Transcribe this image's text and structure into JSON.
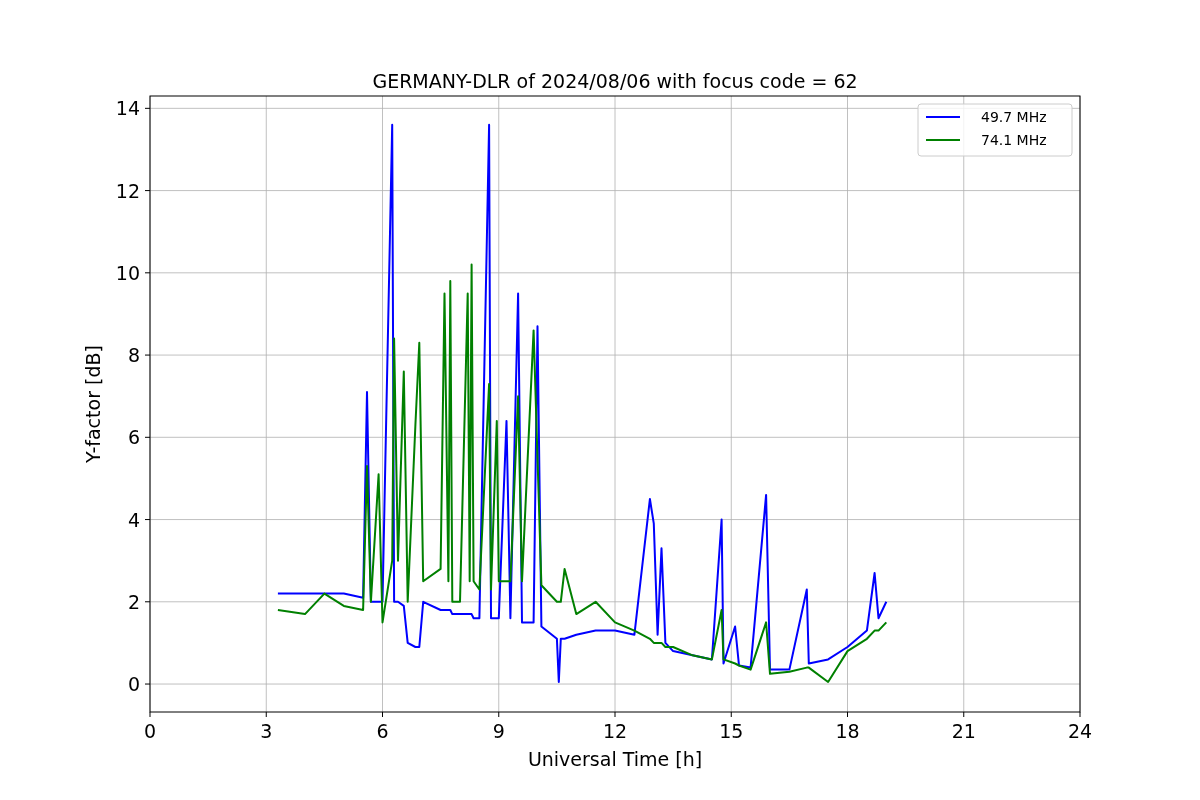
{
  "figure": {
    "chart_data": {
      "type": "line",
      "title": "GERMANY-DLR of 2024/08/06 with focus code = 62",
      "xlabel": "Universal Time [h]",
      "ylabel": "Y-factor [dB]",
      "x": [
        3.3,
        4.0,
        4.5,
        5.0,
        5.5,
        5.6,
        5.7,
        5.9,
        6.0,
        6.25,
        6.3,
        6.4,
        6.55,
        6.65,
        6.85,
        6.95,
        7.05,
        7.5,
        7.6,
        7.7,
        7.75,
        7.8,
        8.0,
        8.2,
        8.25,
        8.3,
        8.35,
        8.5,
        8.75,
        8.8,
        8.95,
        9.0,
        9.2,
        9.3,
        9.5,
        9.6,
        9.9,
        10.0,
        10.1,
        10.5,
        10.55,
        10.6,
        10.7,
        11.0,
        11.5,
        12.0,
        12.5,
        12.9,
        13.0,
        13.1,
        13.2,
        13.3,
        13.5,
        14.0,
        14.5,
        14.75,
        14.8,
        15.1,
        15.2,
        15.5,
        15.9,
        16.0,
        16.5,
        16.95,
        17.0,
        17.5,
        18.0,
        18.5,
        18.7,
        18.8,
        19.0
      ],
      "series": [
        {
          "name": "49.7 MHz",
          "color": "#0000ff",
          "values": [
            2.2,
            2.2,
            2.2,
            2.2,
            2.1,
            7.1,
            2.0,
            2.0,
            2.0,
            13.6,
            2.0,
            2.0,
            1.9,
            1.0,
            0.9,
            0.9,
            2.0,
            1.8,
            1.8,
            1.8,
            1.8,
            1.7,
            1.7,
            1.7,
            1.7,
            1.7,
            1.6,
            1.6,
            13.6,
            1.6,
            1.6,
            1.6,
            6.4,
            1.6,
            9.5,
            1.5,
            1.5,
            8.7,
            1.4,
            1.1,
            0.05,
            1.1,
            1.1,
            1.2,
            1.3,
            1.3,
            1.2,
            4.5,
            3.9,
            1.2,
            3.3,
            1.0,
            0.8,
            0.7,
            0.6,
            4.0,
            0.5,
            1.4,
            0.45,
            0.4,
            4.6,
            0.35,
            0.35,
            2.3,
            0.5,
            0.6,
            0.9,
            1.3,
            2.7,
            1.6,
            2.0
          ]
        },
        {
          "name": "74.1 MHz",
          "color": "#008000",
          "values": [
            1.8,
            1.7,
            2.2,
            1.9,
            1.8,
            5.3,
            2.0,
            5.1,
            1.5,
            3.0,
            8.4,
            3.0,
            7.6,
            2.0,
            6.3,
            8.3,
            2.5,
            2.8,
            9.5,
            2.5,
            9.8,
            2.0,
            2.0,
            9.5,
            2.5,
            10.2,
            2.5,
            2.3,
            7.3,
            2.3,
            6.4,
            2.5,
            2.5,
            2.5,
            7.0,
            2.5,
            8.6,
            5.5,
            2.4,
            2.0,
            2.0,
            2.0,
            2.8,
            1.7,
            2.0,
            1.5,
            1.3,
            1.1,
            1.0,
            1.0,
            1.0,
            0.9,
            0.9,
            0.7,
            0.6,
            1.8,
            0.6,
            0.5,
            0.45,
            0.35,
            1.5,
            0.25,
            0.3,
            0.4,
            0.4,
            0.05,
            0.8,
            1.1,
            1.3,
            1.3,
            1.5
          ]
        }
      ],
      "grid": true,
      "legend": true,
      "xlim": [
        0,
        24
      ],
      "ylim": [
        -0.68,
        14.3
      ],
      "xticks": [
        0,
        3,
        6,
        9,
        12,
        15,
        18,
        21,
        24
      ],
      "yticks": [
        0,
        2,
        4,
        6,
        8,
        10,
        12,
        14
      ]
    }
  }
}
